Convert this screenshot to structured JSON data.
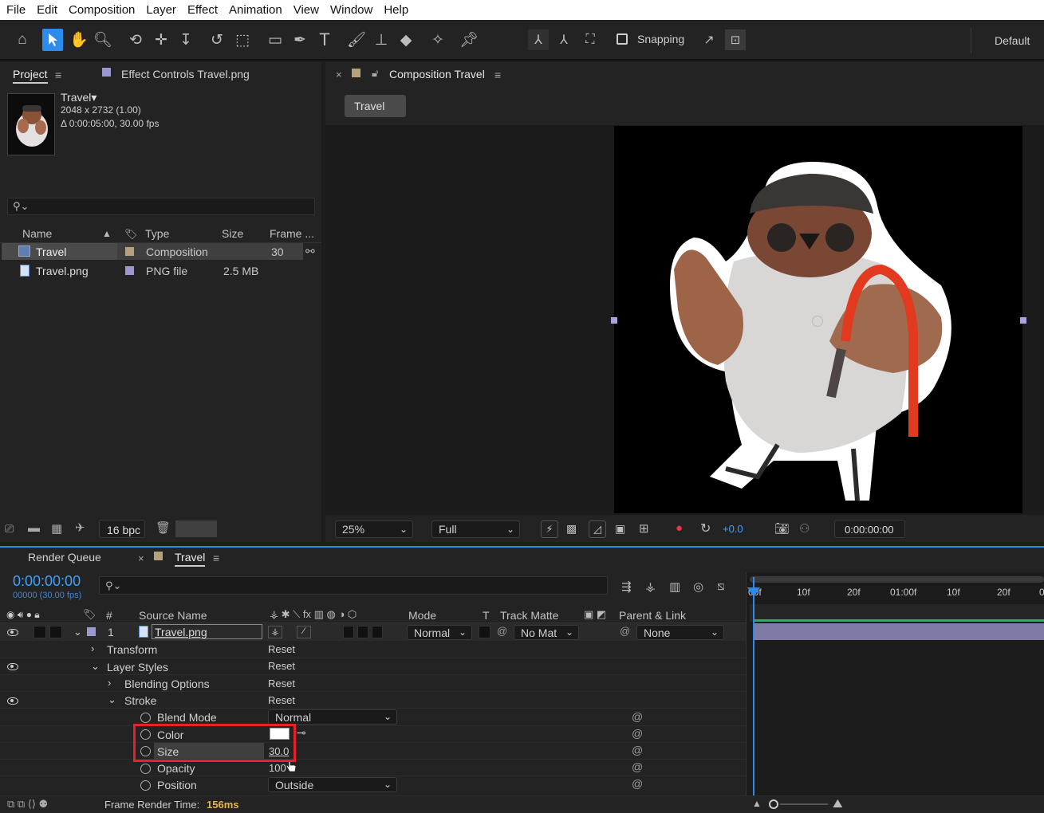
{
  "menu": [
    "File",
    "Edit",
    "Composition",
    "Layer",
    "Effect",
    "Animation",
    "View",
    "Window",
    "Help"
  ],
  "toolbar": {
    "snapping_label": "Snapping",
    "workspace": "Default"
  },
  "project": {
    "tab_label": "Project",
    "effect_controls_label": "Effect Controls Travel.png",
    "comp_name": "Travel▾",
    "comp_dims": "2048 x 2732 (1.00)",
    "comp_duration": "Δ 0:00:05:00, 30.00 fps",
    "search_placeholder": "",
    "columns": {
      "name": "Name",
      "type": "Type",
      "size": "Size",
      "frame": "Frame ..."
    },
    "items": [
      {
        "name": "Travel",
        "type": "Composition",
        "size": "",
        "frame": "30",
        "swatch": "#b6a17a"
      },
      {
        "name": "Travel.png",
        "type": "PNG file",
        "size": "2.5 MB",
        "frame": "",
        "swatch": "#9b97d0"
      }
    ],
    "bpc": "16 bpc"
  },
  "composition": {
    "tab_label": "Composition Travel",
    "breadcrumb": "Travel",
    "zoom": "25%",
    "resolution": "Full",
    "exposure": "+0.0",
    "timecode": "0:00:00:00"
  },
  "timeline": {
    "render_queue_label": "Render Queue",
    "tab_label": "Travel",
    "timecode": "0:00:00:00",
    "frame_info": "00000 (30.00 fps)",
    "ruler": [
      "00f",
      "10f",
      "20f",
      "01:00f",
      "10f",
      "20f",
      "0"
    ],
    "columns": {
      "num": "#",
      "source": "Source Name",
      "mode": "Mode",
      "t": "T",
      "track_matte": "Track Matte",
      "parent": "Parent & Link"
    },
    "layer": {
      "num": "1",
      "name": "Travel.png",
      "mode": "Normal",
      "matte": "No Mat",
      "parent": "None"
    },
    "props": {
      "transform": "Transform",
      "layer_styles": "Layer Styles",
      "blending_options": "Blending Options",
      "stroke": "Stroke",
      "blend_mode": "Blend Mode",
      "blend_mode_value": "Normal",
      "color": "Color",
      "size": "Size",
      "size_value": "30.0",
      "opacity": "Opacity",
      "opacity_value": "100",
      "position": "Position",
      "position_value": "Outside",
      "reset": "Reset"
    },
    "footer_label": "Frame Render Time:",
    "footer_value": "156ms"
  },
  "colors": {
    "accent": "#2d8ceb",
    "highlight": "#e8202a",
    "link": "#3ea2ff",
    "render_time": "#e5b34a"
  }
}
